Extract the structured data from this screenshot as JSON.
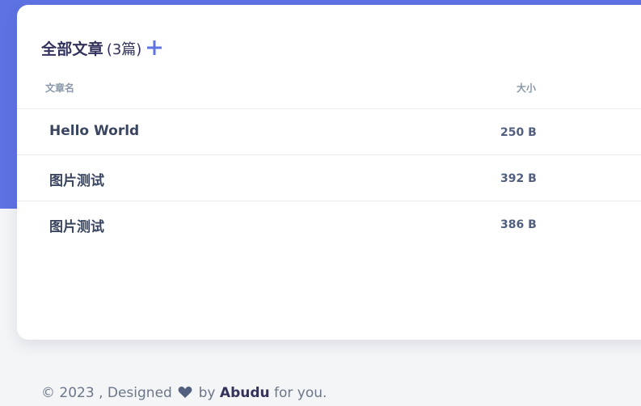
{
  "header": {
    "title": "全部文章",
    "count": "(3篇)",
    "add_icon": "plus-icon",
    "accent": "#5e72e4"
  },
  "table": {
    "columns": [
      "文章名",
      "大小"
    ],
    "rows": [
      {
        "name": "Hello World",
        "size": "250 B"
      },
      {
        "name": "图片测试",
        "size": "392 B"
      },
      {
        "name": "图片测试",
        "size": "386 B"
      }
    ]
  },
  "footer": {
    "prefix": "© 2023 , Designed",
    "heart_icon": "heart-icon",
    "by": "by",
    "author": "Abudu",
    "suffix": "for you."
  }
}
